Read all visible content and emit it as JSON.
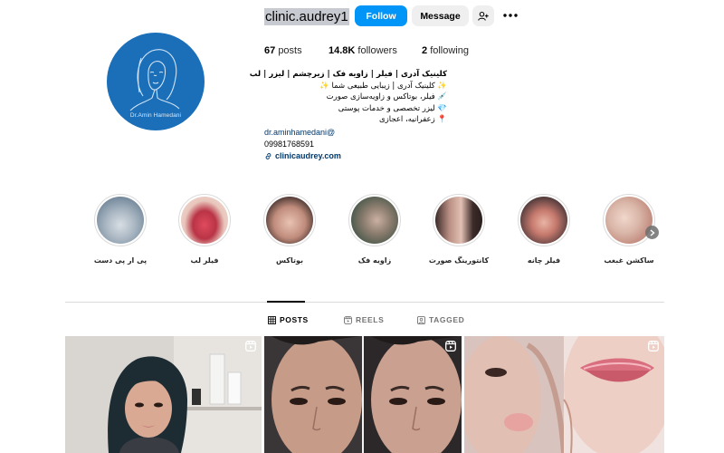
{
  "profile": {
    "username": "clinic.audrey1",
    "follow_label": "Follow",
    "message_label": "Message",
    "avatar_caption": "Dr.Amin Hamedani"
  },
  "stats": {
    "posts_count": "67",
    "posts_label": "posts",
    "followers_count": "14.8K",
    "followers_label": "followers",
    "following_count": "2",
    "following_label": "following"
  },
  "bio": {
    "name": "کلینیک آدری | فیلر | زاویه فک | زیرچشم | لیزر | لب",
    "line1": "✨ کلینیک آدری | زیبایی طبیعی شما ✨",
    "line2": "💉 فیلر، بوتاکس و زاویه‌سازی صورت",
    "line3": "💎 لیزر تخصصی و خدمات پوستی",
    "line4": "📍 زعفرانیه، اعجازی",
    "email": "dr.aminhamedani@",
    "phone": "09981768591",
    "link": "clinicaudrey.com"
  },
  "highlights": [
    {
      "label": "ساکشن غبغب",
      "color": "#d9c0b4"
    },
    {
      "label": "فیلر چانه",
      "color": "#b98c80"
    },
    {
      "label": "کانتورینگ صورت",
      "color": "#8a6a60"
    },
    {
      "label": "زاویه فک",
      "color": "#6f7466"
    },
    {
      "label": "بوتاکس",
      "color": "#7a5a50"
    },
    {
      "label": "فیلر لب",
      "color": "#c0505a"
    },
    {
      "label": "پی ار پی دست",
      "color": "#9aa6b0"
    }
  ],
  "tabs": {
    "posts": "POSTS",
    "reels": "REELS",
    "tagged": "TAGGED"
  },
  "colors": {
    "accent": "#0095f6",
    "avatar_bg": "#1a6fb8",
    "link": "#00376b"
  }
}
